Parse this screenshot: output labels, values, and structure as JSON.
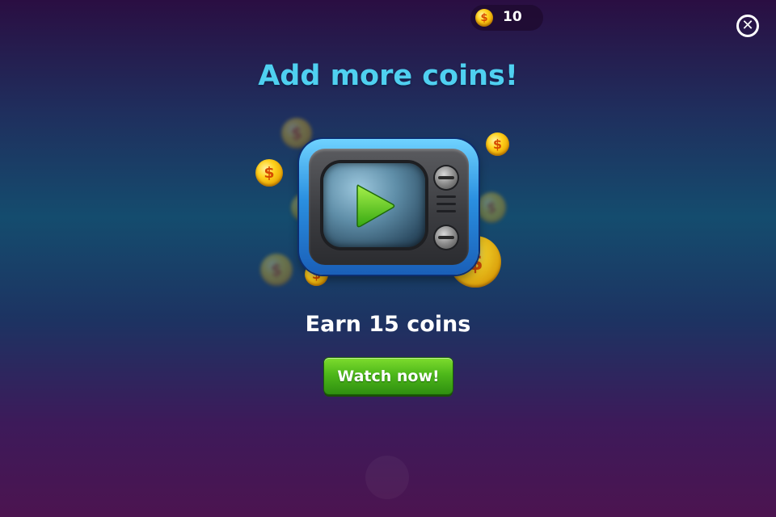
{
  "hud": {
    "coin_count": "10",
    "coin_icon": "coin-icon"
  },
  "dialog": {
    "title": "Add more coins!",
    "reward_text": "Earn 15 coins",
    "watch_button_label": "Watch now!",
    "close_icon": "close-icon",
    "video_icon": "tv-play-icon"
  },
  "colors": {
    "title": "#4fd0f0",
    "button": "#4eb81a",
    "coin": "#ffd21e"
  }
}
